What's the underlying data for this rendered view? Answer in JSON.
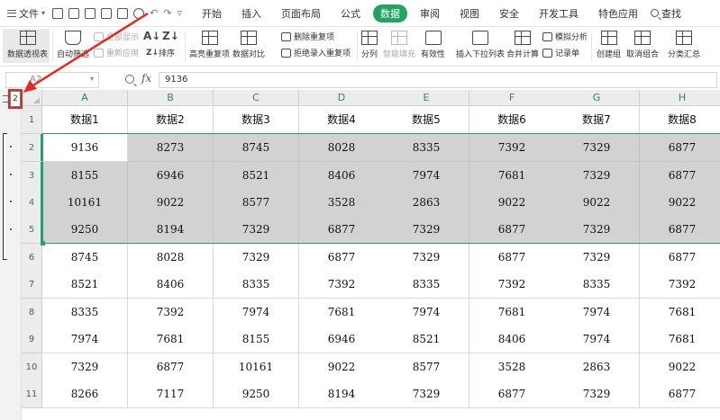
{
  "menubar": {
    "file_label": "文件",
    "tabs": [
      "开始",
      "插入",
      "页面布局",
      "公式",
      "数据",
      "审阅",
      "视图",
      "安全",
      "开发工具",
      "特色应用"
    ],
    "active_tab": "数据",
    "search_label": "查找"
  },
  "ribbon": {
    "pivot_table": "数据透视表",
    "auto_filter": "自动筛选",
    "show_all": "全部显示",
    "reapply": "重新应用",
    "sort": "排序",
    "highlight_dup": "高亮重复项",
    "remove_dup": "删除重复项",
    "reject_dup": "拒绝录入重复项",
    "data_compare": "数据对比",
    "split": "分列",
    "smart_fill": "智能填充",
    "validity": "有效性",
    "insert_dropdown": "插入下拉列表",
    "merge_calc": "合并计算",
    "sim_analysis": "模拟分析",
    "record_sheet": "记录单",
    "create_group": "创建组",
    "ungroup": "取消组合",
    "subtotal": "分类汇总"
  },
  "formula_bar": {
    "name_box": "A2",
    "fx": "fx",
    "value": "9136"
  },
  "outline": {
    "level_label": "2"
  },
  "grid": {
    "columns": [
      "A",
      "B",
      "C",
      "D",
      "E",
      "F",
      "G",
      "H"
    ],
    "row_numbers": [
      "1",
      "2",
      "3",
      "4",
      "5",
      "6",
      "7",
      "8",
      "9",
      "10",
      "11"
    ],
    "header_row": [
      "数据1",
      "数据2",
      "数据3",
      "数据4",
      "数据5",
      "数据6",
      "数据7",
      "数据8"
    ],
    "rows": [
      [
        "9136",
        "8273",
        "8745",
        "8028",
        "8335",
        "7392",
        "7329",
        "6877"
      ],
      [
        "8155",
        "6946",
        "8521",
        "8406",
        "7974",
        "7681",
        "7329",
        "6877"
      ],
      [
        "10161",
        "9022",
        "8577",
        "3528",
        "2863",
        "9022",
        "9022",
        "9022"
      ],
      [
        "9250",
        "8194",
        "7329",
        "6877",
        "7329",
        "6877",
        "7329",
        "6877"
      ],
      [
        "8745",
        "8028",
        "7329",
        "6877",
        "7329",
        "6877",
        "7329",
        "6877"
      ],
      [
        "8521",
        "8406",
        "8335",
        "7392",
        "8335",
        "7392",
        "8335",
        "7392"
      ],
      [
        "8335",
        "7392",
        "7974",
        "7681",
        "7974",
        "7681",
        "7974",
        "7681"
      ],
      [
        "7974",
        "7681",
        "8155",
        "6946",
        "8521",
        "8406",
        "7974",
        "7681"
      ],
      [
        "7329",
        "6877",
        "10161",
        "9022",
        "8577",
        "3528",
        "2863",
        "9022"
      ],
      [
        "8266",
        "7117",
        "9250",
        "8194",
        "7329",
        "6877",
        "7329",
        "6877"
      ]
    ]
  },
  "colors": {
    "accent_green": "#1fa463",
    "selection_fill": "#d2d2d2",
    "annotation_red": "#e22a21"
  }
}
